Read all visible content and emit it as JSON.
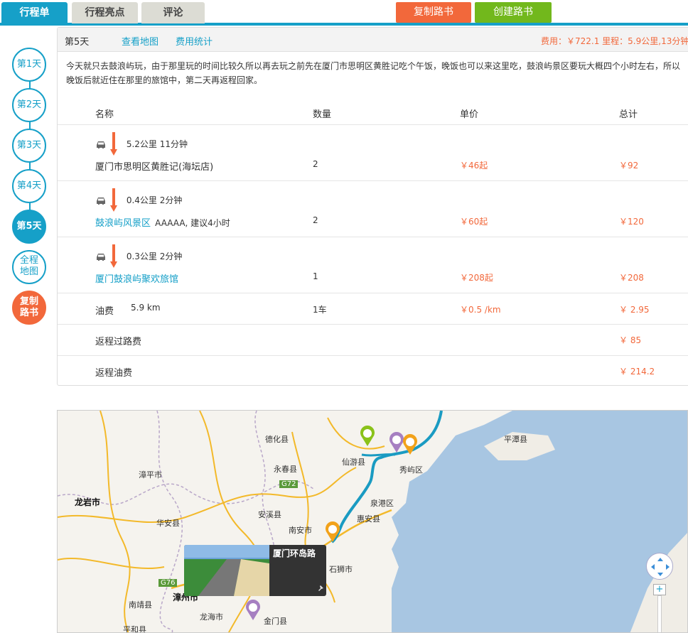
{
  "tabs": [
    {
      "label": "行程单"
    },
    {
      "label": "行程亮点"
    },
    {
      "label": "评论"
    }
  ],
  "actions": {
    "copy": "复制路书",
    "create": "创建路书"
  },
  "daynav": {
    "days": [
      "第1天",
      "第2天",
      "第3天",
      "第4天",
      "第5天"
    ],
    "overview_line1": "全程",
    "overview_line2": "地图",
    "copy_line1": "复制",
    "copy_line2": "路书"
  },
  "panel": {
    "day": "第5天",
    "view_map": "查看地图",
    "cost_stats": "费用统计",
    "summary": "费用：￥722.1    里程：5.9公里,13分钟",
    "description": "今天就只去鼓浪屿玩，由于那里玩的时间比较久所以再去玩之前先在厦门市思明区黄胜记吃个午饭，晚饭也可以来这里吃，鼓浪屿景区要玩大概四个小时左右，所以晚饭后就近住在那里的旅馆中，第二天再返程回家。",
    "headers": {
      "name": "名称",
      "qty": "数量",
      "price": "单价",
      "total": "总计"
    },
    "items": [
      {
        "transit": "5.2公里   11分钟",
        "name": "厦门市思明区黄胜记(海坛店)",
        "extra": "",
        "qty": "2",
        "price": "￥46起",
        "total": "￥92"
      },
      {
        "transit": "0.4公里   2分钟",
        "name": "鼓浪屿风景区",
        "extra": "AAAAA, 建议4小时",
        "qty": "2",
        "price": "￥60起",
        "total": "￥120"
      },
      {
        "transit": "0.3公里   2分钟",
        "name": "厦门鼓浪屿聚欢旅馆",
        "extra": "",
        "qty": "1",
        "price": "￥208起",
        "total": "￥208"
      }
    ],
    "fuel": {
      "name": "油费",
      "distance": "5.9 km",
      "qty": "1车",
      "price": "￥0.5 /km",
      "total": "￥ 2.95"
    },
    "toll": {
      "name": "返程过路费",
      "total": "￥ 85"
    },
    "return_fuel": {
      "name": "返程油费",
      "total": "￥ 214.2"
    }
  },
  "map": {
    "labels": [
      "德化县",
      "漳平市",
      "永春县",
      "仙游县",
      "秀屿区",
      "平潭县",
      "龙岩市",
      "G72",
      "安溪县",
      "泉港区",
      "华安县",
      "惠安县",
      "南安市",
      "石狮市",
      "G76",
      "漳州市",
      "南靖县",
      "龙海市",
      "金门县",
      "平和县"
    ],
    "popup_title": "厦门环岛路"
  },
  "colors": {
    "accent": "#16a0c8",
    "orange": "#f2683b",
    "green": "#72b81c"
  }
}
